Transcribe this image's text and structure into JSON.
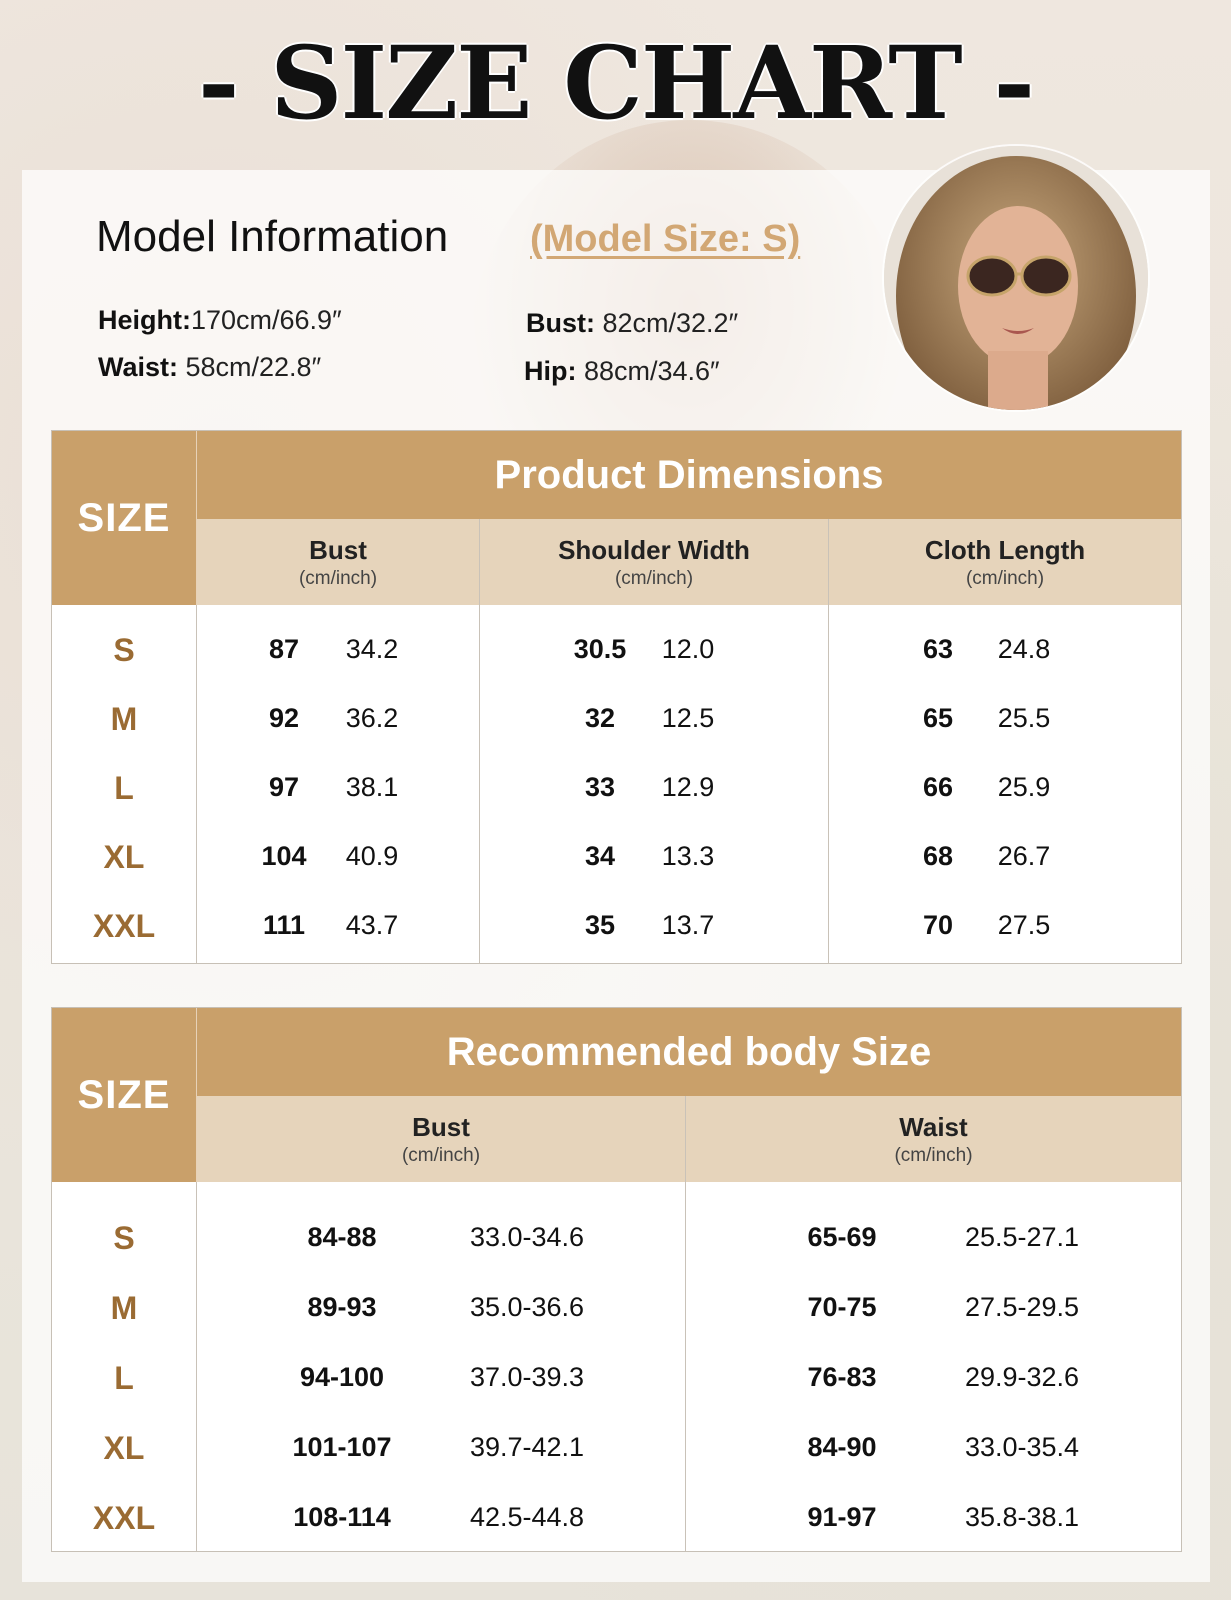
{
  "title": "- SIZE CHART -",
  "model": {
    "heading": "Model Information",
    "size_note": "(Model Size: S)",
    "height_label": "Height:",
    "height_value": "170cm/66.9″",
    "waist_label": "Waist:",
    "waist_value": " 58cm/22.8″",
    "bust_label": "Bust:",
    "bust_value": " 82cm/32.2″",
    "hip_label": "Hip:",
    "hip_value": " 88cm/34.6″"
  },
  "product_dimensions": {
    "size_header": "SIZE",
    "title": "Product Dimensions",
    "columns": [
      {
        "name": "Bust",
        "unit": "(cm/inch)"
      },
      {
        "name": "Shoulder Width",
        "unit": "(cm/inch)"
      },
      {
        "name": "Cloth Length",
        "unit": "(cm/inch)"
      }
    ],
    "rows": [
      {
        "size": "S",
        "v": [
          "87",
          "34.2",
          "30.5",
          "12.0",
          "63",
          "24.8"
        ]
      },
      {
        "size": "M",
        "v": [
          "92",
          "36.2",
          "32",
          "12.5",
          "65",
          "25.5"
        ]
      },
      {
        "size": "L",
        "v": [
          "97",
          "38.1",
          "33",
          "12.9",
          "66",
          "25.9"
        ]
      },
      {
        "size": "XL",
        "v": [
          "104",
          "40.9",
          "34",
          "13.3",
          "68",
          "26.7"
        ]
      },
      {
        "size": "XXL",
        "v": [
          "111",
          "43.7",
          "35",
          "13.7",
          "70",
          "27.5"
        ]
      }
    ]
  },
  "recommended": {
    "size_header": "SIZE",
    "title": "Recommended body Size",
    "columns": [
      {
        "name": "Bust",
        "unit": "(cm/inch)"
      },
      {
        "name": "Waist",
        "unit": "(cm/inch)"
      }
    ],
    "rows": [
      {
        "size": "S",
        "v": [
          "84-88",
          "33.0-34.6",
          "65-69",
          "25.5-27.1"
        ]
      },
      {
        "size": "M",
        "v": [
          "89-93",
          "35.0-36.6",
          "70-75",
          "27.5-29.5"
        ]
      },
      {
        "size": "L",
        "v": [
          "94-100",
          "37.0-39.3",
          "76-83",
          "29.9-32.6"
        ]
      },
      {
        "size": "XL",
        "v": [
          "101-107",
          "39.7-42.1",
          "84-90",
          "33.0-35.4"
        ]
      },
      {
        "size": "XXL",
        "v": [
          "108-114",
          "42.5-44.8",
          "91-97",
          "35.8-38.1"
        ]
      }
    ]
  }
}
